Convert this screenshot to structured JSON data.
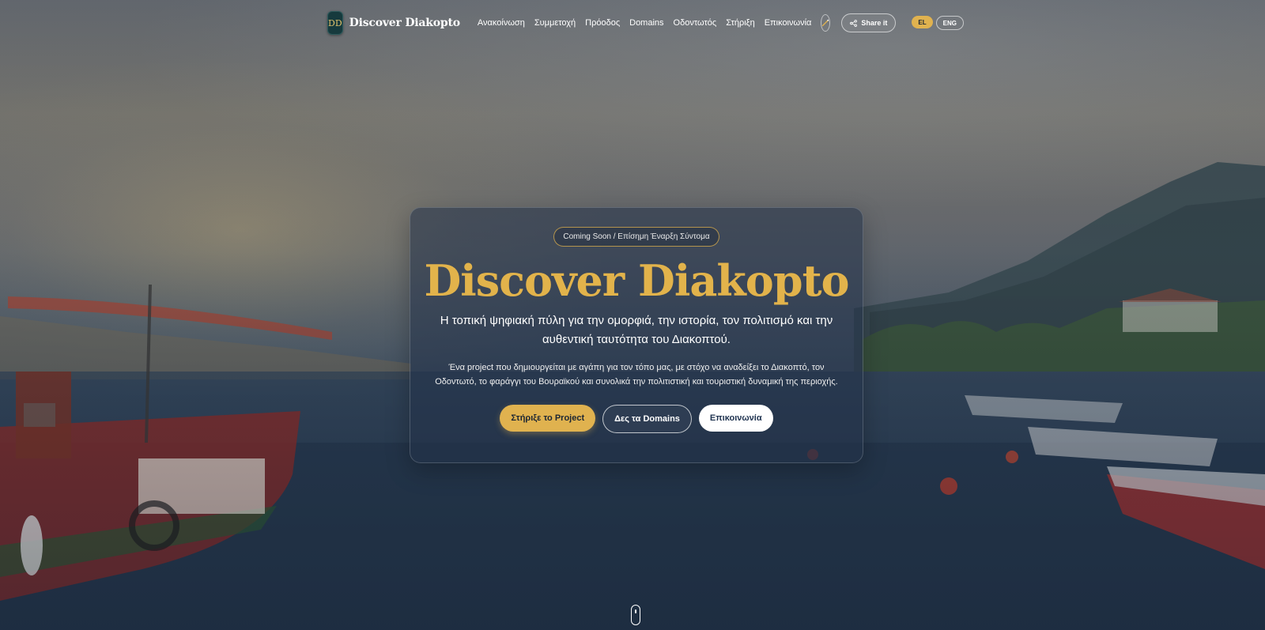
{
  "nav": {
    "brand": "Discover Diakopto",
    "logo_monogram": "DD",
    "items": [
      {
        "label": "Ανακοίνωση"
      },
      {
        "label": "Συμμετοχή"
      },
      {
        "label": "Πρόοδος"
      },
      {
        "label": "Domains"
      },
      {
        "label": "Οδοντωτός"
      },
      {
        "label": "Στήριξη"
      },
      {
        "label": "Επικοινωνία"
      }
    ],
    "theme_icon": "magic-wand-icon",
    "share_label": "Share it",
    "languages": {
      "el": "EL",
      "en": "ENG"
    }
  },
  "hero": {
    "badge": "Coming Soon / Επίσημη Έναρξη Σύντομα",
    "title": "Discover Diakopto",
    "subtitle": "Η τοπική ψηφιακή πύλη για την ομορφιά, την ιστορία, τον πολιτισμό και την αυθεντική ταυτότητα του Διακοπτού.",
    "description": "Ένα project που δημιουργείται με αγάπη για τον τόπο μας, με στόχο να αναδείξει το Διακοπτό, τον Οδοντωτό, το φαράγγι του Βουραϊκού και συνολικά την πολιτιστική και τουριστική δυναμική της περιοχής.",
    "buttons": {
      "support": "Στήριξε το Project",
      "domains": "Δες τα Domains",
      "contact": "Επικοινωνία"
    }
  },
  "colors": {
    "accent_gold": "#e0b24f",
    "title_gold": "#e2b34b",
    "card_bg": "#233248",
    "contact_text": "#1f3350"
  }
}
